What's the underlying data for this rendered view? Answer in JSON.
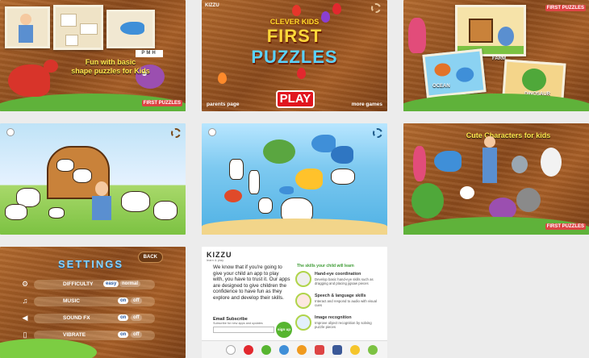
{
  "tile1": {
    "caption_line1": "Fun with basic",
    "caption_line2": "shape puzzles for Kids",
    "logo": "FIRST PUZZLES",
    "puzzle_letters": "PMH"
  },
  "tile2": {
    "top_title": "CLEVER KIDS",
    "title_line1": "FIRST",
    "title_line2": "PUZZLES",
    "play_label": "PLAY",
    "parents_label": "parents page",
    "more_games_label": "more games",
    "brand": "KIZZU"
  },
  "tile3": {
    "card_farm": "FARM",
    "card_ocean": "OCEAN",
    "card_dinosaur": "DINOSAUR",
    "logo": "FIRST PUZZLES"
  },
  "tile6": {
    "caption": "Cute Characters for kids",
    "logo": "FIRST PUZZLES"
  },
  "settings": {
    "title": "SETTINGS",
    "back_label": "BACK",
    "rows": [
      {
        "label": "DIFFICULTY",
        "opt_a": "easy",
        "opt_b": "normal",
        "icon": "gear-icon"
      },
      {
        "label": "MUSIC",
        "opt_a": "on",
        "opt_b": "off",
        "icon": "music-note-icon"
      },
      {
        "label": "SOUND FX",
        "opt_a": "on",
        "opt_b": "off",
        "icon": "speaker-icon"
      },
      {
        "label": "VIBRATE",
        "opt_a": "on",
        "opt_b": "off",
        "icon": "vibrate-icon"
      }
    ]
  },
  "parents": {
    "brand": "KIZZU",
    "brand_sub": "learn & play",
    "trust_text": "We know that if you're going to give your child an app to play with, you have to trust it. Our apps are designed to give children the confidence to have fun as they explore and develop their skills.",
    "skills_heading": "The skills your child will learn",
    "skills": [
      {
        "name": "Hand-eye coordination",
        "desc": "Develop basic hand-eye skills such as dragging and placing jigsaw pieces"
      },
      {
        "name": "Speech & language skills",
        "desc": "Interact and respond to audio with visual cues"
      },
      {
        "name": "Image recognition",
        "desc": "Improve object recognition by solving puzzle pieces"
      }
    ],
    "email_title": "Email Subscribe",
    "email_sub": "Subscribe for new apps and updates",
    "signup_label": "sign up"
  },
  "colors": {
    "wood": "#9a5322",
    "grass": "#5fb23a",
    "play_red": "#e1161f",
    "title_yellow": "#ffdd2e",
    "skills_green": "#3d9b33"
  }
}
